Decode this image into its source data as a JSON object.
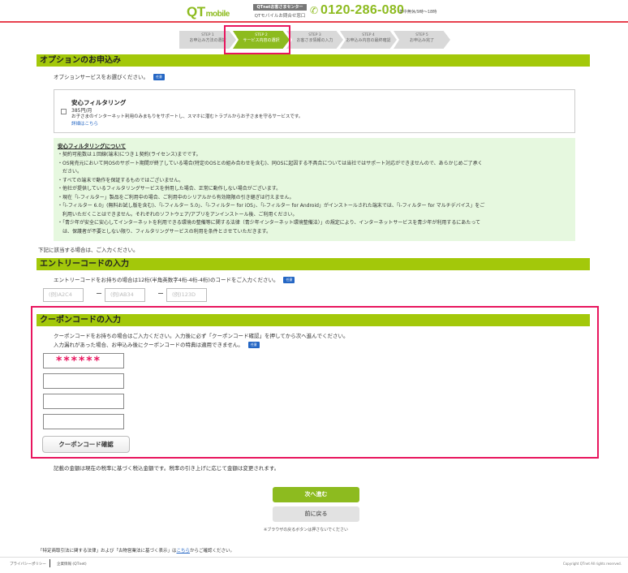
{
  "header": {
    "logo_main": "QT",
    "logo_sub": "mobile",
    "center_badge": "QTnetお客さまセンター",
    "center_sub": "QTモバイルお問合せ窓口",
    "phone": "0120-286-080",
    "hours": "年中無休/9時〜18時"
  },
  "steps": [
    {
      "num": "STEP 1",
      "label": "お申込み方法の選択"
    },
    {
      "num": "STEP 2",
      "label": "サービス内容の選択"
    },
    {
      "num": "STEP 3",
      "label": "お客さま情報の入力"
    },
    {
      "num": "STEP 4",
      "label": "お申込み内容の最終確認"
    },
    {
      "num": "STEP 5",
      "label": "お申込み完了"
    }
  ],
  "option": {
    "section_title": "オプションのお申込み",
    "instruction": "オプションサービスをお選びください。",
    "tag": "任意",
    "item_title": "安心フィルタリング",
    "item_price": "385円/月",
    "item_desc": "お子さまのインターネット利用のみまもりをサポートし、スマホに潜むトラブルからお子さまを守るサービスです。",
    "item_link": "詳細はこちら"
  },
  "notice": {
    "title": "安心フィルタリングについて",
    "lines": [
      "・契約可能数は１回線(端末)につき１契約(ライセンス)までです。",
      "・OS発売元において同OSのサポート期間が終了している場合(特定のOSとの組み合わせを含む)、同OSに起因する不具合については当社ではサポート対応ができませんので、あらかじめご了承く",
      "　ださい。",
      "・すべての端末で動作を保証するものではございません。",
      "・他社が提供しているフィルタリングサービスを併用した場合、正常に動作しない場合がございます。",
      "・現在「i-フィルター」製品をご利用中の場合、ご利用中のシリアルから有効期限の引き継ぎは行えません。",
      "・「i-フィルター 6.0」(無料お試し版を含む)、「i-フィルター 5.0」、「i-フィルター for iOS」、「i-フィルター for Android」がインストールされた端末では、「i-フィルター for マルチデバイス」をご",
      "　利用いただくことはできません。それぞれのソフトウェア/アプリをアンインストール後、ご利用ください。",
      "・「青少年が安全に安心してインターネットを利用できる環境の整備等に関する法律（青少年インターネット環境整備法）」の規定により、インターネットサービスを青少年が利用するにあたって",
      "　は、保護者が不要としない限り、フィルタリングサービスの利用を条件とさせていただきます。"
    ],
    "after": "下記に該当する場合は、ご入力ください。"
  },
  "entry": {
    "section_title": "エントリーコードの入力",
    "instruction": "エントリーコードをお持ちの場合は12桁(半角英数字4桁-4桁-4桁)のコードをご入力ください。",
    "tag": "任意",
    "placeholders": [
      "(例)A2C4",
      "(例)AB34",
      "(例)123D"
    ]
  },
  "coupon": {
    "section_title": "クーポンコードの入力",
    "line1": "クーポンコードをお持ちの場合はご入力ください。入力後に必ず「クーポンコード確認」を押してから次へ進んでください。",
    "line2": "入力漏れがあった場合、お申込み後にクーポンコードの特典は適用できません。",
    "tag": "任意",
    "code1_value": "******",
    "confirm_label": "クーポンコード確認"
  },
  "tax_note": "記載の金額は現在の税率に基づく税込金額です。税率の引き上げに応じて金額は変更されます。",
  "next_label": "次へ進む",
  "back_label": "前に戻る",
  "back_note": "※ブラウザの戻るボタンは押さないでください",
  "law_note_prefix": "「特定商取引法に関する法律」および「古物営業法に基づく表示」は",
  "law_note_link": "こちら",
  "law_note_suffix": "からご確認ください。",
  "footer": {
    "privacy": "プライバシーポリシー",
    "company": "企業情報 (QTnet)",
    "copyright": "Copyright QTnet All rights reserved."
  }
}
